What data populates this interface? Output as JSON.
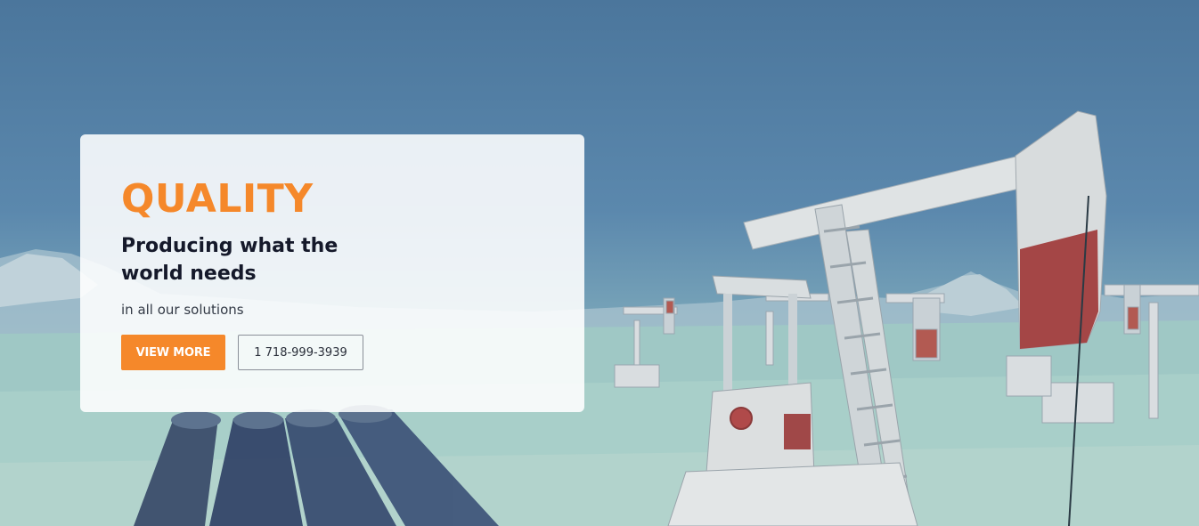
{
  "hero": {
    "title": "QUALITY",
    "subtitle": "Producing what the world needs",
    "tagline": "in all our solutions",
    "primary_button": "VIEW MORE",
    "secondary_button": "1 718-999-3939"
  },
  "colors": {
    "accent": "#f5882a",
    "heading": "#15192a",
    "overlay_tint": "#4b769c"
  }
}
